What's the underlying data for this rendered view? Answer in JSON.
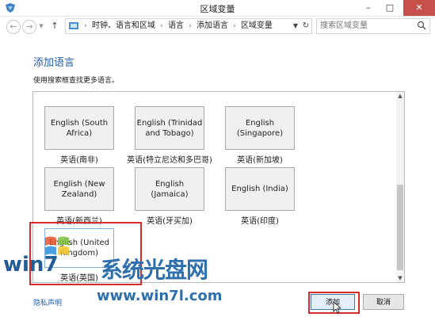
{
  "window": {
    "title": "区域变量"
  },
  "nav": {
    "back_icon": "←",
    "forward_icon": "→",
    "dropdown_icon": "▾",
    "up_icon": "↑",
    "breadcrumbs": [
      "时钟、语言和区域",
      "语言",
      "添加语言",
      "区域变量"
    ],
    "search_placeholder": "搜索区域变量"
  },
  "main": {
    "heading": "添加语言",
    "subtitle": "使用搜索框查找更多语言。"
  },
  "languages": [
    {
      "tile": "English (South Africa)",
      "caption": "英语(南非)"
    },
    {
      "tile": "English (Trinidad and Tobago)",
      "caption": "英语(特立尼达和多巴哥)"
    },
    {
      "tile": "English (Singapore)",
      "caption": "英语(新加坡)"
    },
    {
      "tile": "English (New Zealand)",
      "caption": "英语(新西兰)"
    },
    {
      "tile": "English (Jamaica)",
      "caption": "英语(牙买加)"
    },
    {
      "tile": "English (India)",
      "caption": "英语(印度)"
    },
    {
      "tile": "English (United Kingdom)",
      "caption": "英语(英国)"
    }
  ],
  "watermark": {
    "title": "系统光盘网",
    "url": "www.win7l.com",
    "logo_text": "win7"
  },
  "footer": {
    "privacy_link": "隐私声明",
    "add_button": "添加",
    "cancel_button": "取消"
  },
  "colors": {
    "accent": "#1f5fa8",
    "highlight_box": "#d62b2b",
    "close_button": "#c7504b"
  }
}
